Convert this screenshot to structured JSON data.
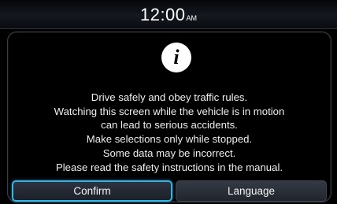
{
  "status_bar": {
    "time": "12:00",
    "ampm": "AM"
  },
  "dialog": {
    "icon": "info-icon",
    "message_lines": [
      "Drive safely and obey traffic rules.",
      "Watching this screen while the vehicle is in motion",
      "can lead to serious accidents.",
      "Make selections only while stopped.",
      "Some data may be incorrect.",
      "Please read the safety instructions in the manual."
    ],
    "buttons": {
      "confirm_label": "Confirm",
      "language_label": "Language"
    }
  },
  "colors": {
    "background": "#000000",
    "focus_accent": "#33b4e6",
    "text": "#f2f2f2"
  }
}
